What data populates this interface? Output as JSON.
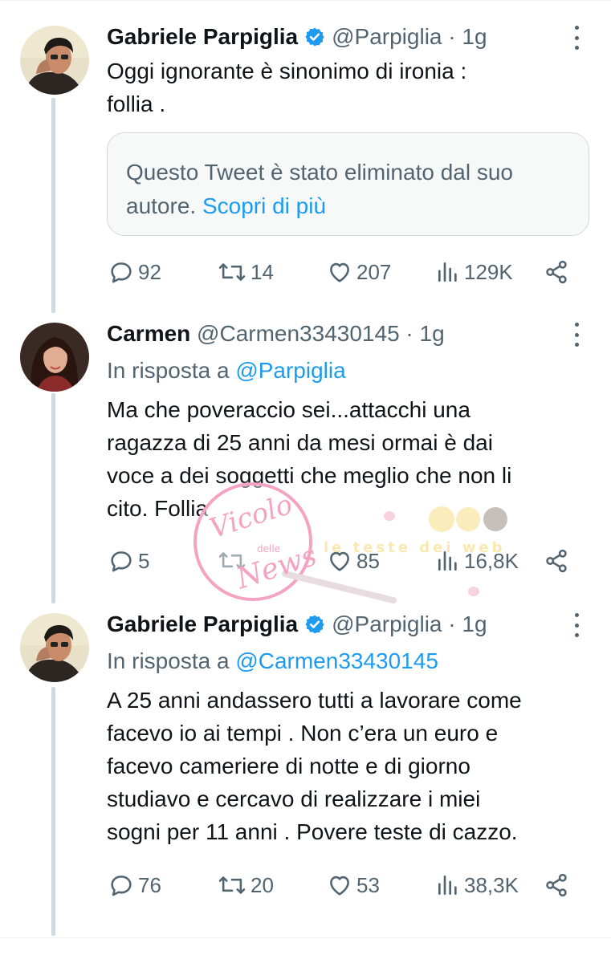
{
  "tweets": [
    {
      "name": "Gabriele Parpiglia",
      "handle": "@Parpiglia",
      "dot": "·",
      "time": "1g",
      "text_lines": [
        "Oggi ignorante è sinonimo di ironia :",
        "follia ."
      ],
      "quoted_deleted": {
        "text": "Questo Tweet è stato eliminato dal suo autore.",
        "link": "Scopri di più"
      },
      "stats": {
        "replies": "92",
        "retweets": "14",
        "likes": "207",
        "views": "129K"
      }
    },
    {
      "name": "Carmen",
      "handle": "@Carmen33430145",
      "dot": "·",
      "time": "1g",
      "reply_prefix": "In risposta a",
      "reply_mention": "@Parpiglia",
      "text_lines": [
        "Ma che poveraccio sei...attacchi una",
        "ragazza di 25 anni da mesi ormai è dai",
        "voce a dei soggetti che meglio che non li",
        "cito. Follia"
      ],
      "stats": {
        "replies": "5",
        "retweets": "",
        "likes": "85",
        "views": "16,8K"
      }
    },
    {
      "name": "Gabriele Parpiglia",
      "handle": "@Parpiglia",
      "dot": "·",
      "time": "1g",
      "reply_prefix": "In risposta a",
      "reply_mention": "@Carmen33430145",
      "text_lines": [
        "A 25 anni andassero tutti a lavorare come",
        "facevo io ai tempi . Non c’era un euro e",
        "facevo cameriere di notte e di giorno",
        "studiavo e cercavo di realizzare i miei",
        "sogni per 11 anni . Povere teste di cazzo."
      ],
      "stats": {
        "replies": "76",
        "retweets": "20",
        "likes": "53",
        "views": "38,3K"
      }
    }
  ],
  "watermark": {
    "line1": "Vicolo",
    "line2": "delle",
    "line3": "News",
    "banner": "le teste dei web"
  },
  "colors": {
    "accent": "#1d9bf0",
    "text": "#0f1419",
    "secondary": "#536471",
    "thread_line": "#cfd9de",
    "watermark_pink": "#f4a3c0"
  },
  "icons": [
    "more-icon",
    "verified-badge-icon",
    "reply-icon",
    "retweet-icon",
    "like-icon",
    "views-icon",
    "share-icon"
  ]
}
